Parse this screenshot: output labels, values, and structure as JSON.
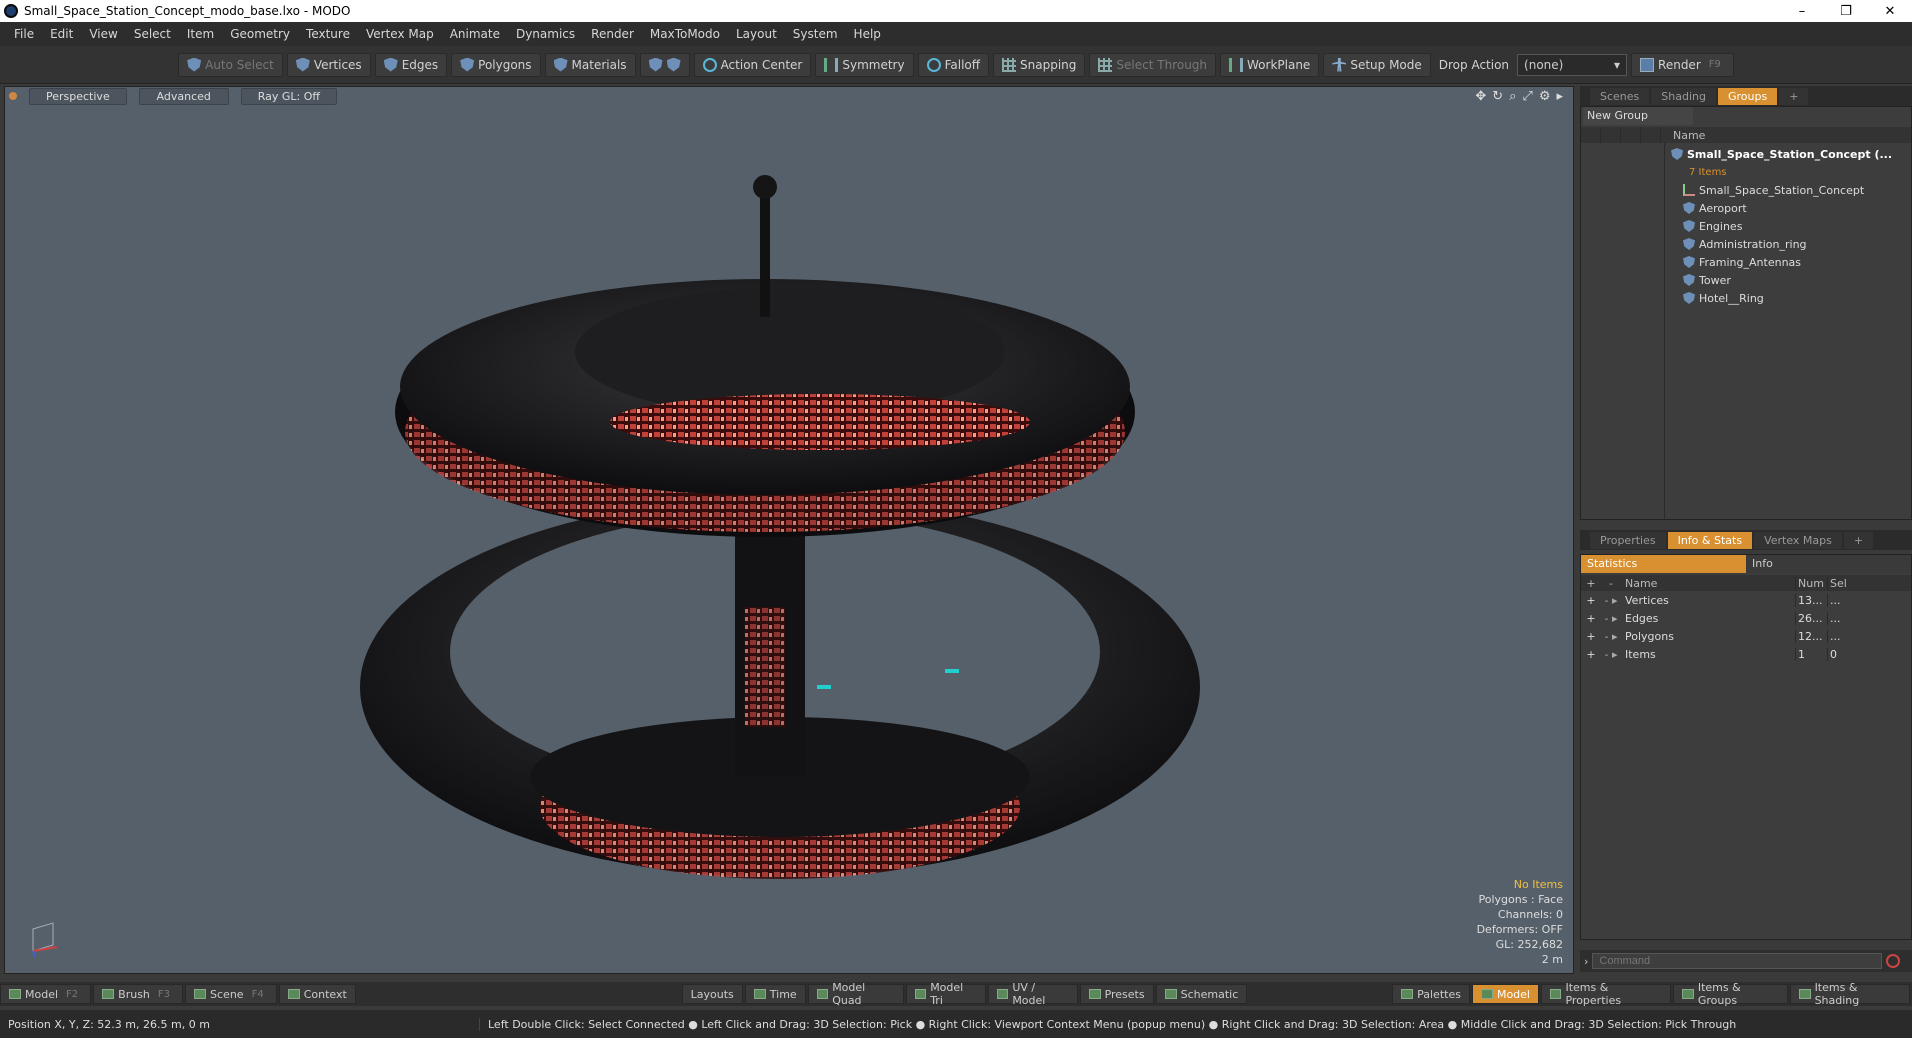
{
  "window": {
    "title": "Small_Space_Station_Concept_modo_base.lxo - MODO",
    "minimize": "–",
    "maximize": "❐",
    "close": "✕"
  },
  "menu": [
    "File",
    "Edit",
    "View",
    "Select",
    "Item",
    "Geometry",
    "Texture",
    "Vertex Map",
    "Animate",
    "Dynamics",
    "Render",
    "MaxToModo",
    "Layout",
    "System",
    "Help"
  ],
  "toolbar": {
    "auto_select": "Auto Select",
    "vertices": "Vertices",
    "edges": "Edges",
    "polygons": "Polygons",
    "materials": "Materials",
    "action_center": "Action Center",
    "symmetry": "Symmetry",
    "falloff": "Falloff",
    "snapping": "Snapping",
    "select_through": "Select Through",
    "workplane": "WorkPlane",
    "setup_mode": "Setup Mode",
    "drop_action": "Drop Action",
    "drop_value": "(none)",
    "render": "Render",
    "render_key": "F9"
  },
  "viewport": {
    "tabs": [
      "Perspective",
      "Advanced",
      "Ray GL: Off"
    ],
    "stats": {
      "no_items": "No Items",
      "polygons": "Polygons : Face",
      "channels": "Channels: 0",
      "deformers": "Deformers: OFF",
      "gl": "GL: 252,682",
      "scale": "2 m"
    }
  },
  "groups_tabs": [
    "Scenes",
    "Shading",
    "Groups"
  ],
  "groups": {
    "new_group": "New Group",
    "name_col": "Name",
    "root": "Small_Space_Station_Concept (...",
    "root_sub": "7 Items",
    "children": [
      "Small_Space_Station_Concept",
      "Aeroport",
      "Engines",
      "Administration_ring",
      "Framing_Antennas",
      "Tower",
      "Hotel__Ring"
    ]
  },
  "props_tabs": [
    "Properties",
    "Info & Stats",
    "Vertex Maps"
  ],
  "stats": {
    "tab_statistics": "Statistics",
    "tab_info": "Info",
    "col_name": "Name",
    "col_num": "Num",
    "col_sel": "Sel",
    "rows": [
      {
        "name": "Vertices",
        "num": "13...",
        "sel": "..."
      },
      {
        "name": "Edges",
        "num": "26...",
        "sel": "..."
      },
      {
        "name": "Polygons",
        "num": "12...",
        "sel": "..."
      },
      {
        "name": "Items",
        "num": "1",
        "sel": "0"
      }
    ]
  },
  "command": {
    "placeholder": "Command"
  },
  "bottom": {
    "model": "Model",
    "model_key": "F2",
    "brush": "Brush",
    "brush_key": "F3",
    "scene": "Scene",
    "scene_key": "F4",
    "context": "Context",
    "layouts": "Layouts",
    "time": "Time",
    "model_quad": "Model Quad",
    "model_tri": "Model Tri",
    "uv_model": "UV / Model",
    "presets": "Presets",
    "schematic": "Schematic",
    "palettes": "Palettes",
    "model_active": "Model",
    "items_props": "Items & Properties",
    "items_groups": "Items & Groups",
    "items_shading": "Items & Shading"
  },
  "status": {
    "position": "Position X, Y, Z:   52.3 m, 26.5 m, 0 m",
    "hint": "Left Double Click: Select Connected ● Left Click and Drag: 3D Selection: Pick ● Right Click: Viewport Context Menu (popup menu) ● Right Click and Drag: 3D Selection: Area ● Middle Click and Drag: 3D Selection: Pick Through"
  },
  "colors": {
    "accent": "#d89030",
    "viewport_bg": "#56606a"
  }
}
